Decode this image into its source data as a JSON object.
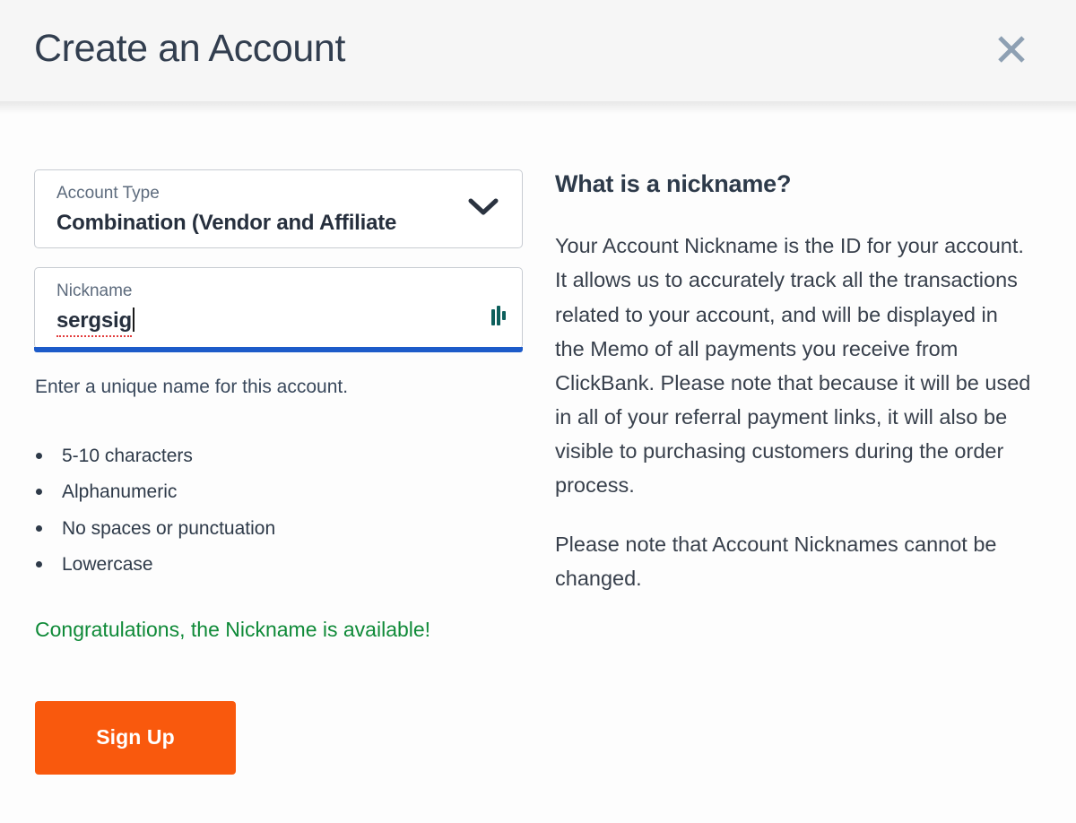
{
  "header": {
    "title": "Create an Account",
    "close_icon": "close-icon"
  },
  "form": {
    "account_type": {
      "label": "Account Type",
      "value": "Combination (Vendor and Affiliate",
      "chevron_icon": "chevron-down-icon"
    },
    "nickname": {
      "label": "Nickname",
      "value": "sergsig",
      "status_icon": "loading-bars-icon"
    },
    "helper_text": "Enter a unique name for this account.",
    "rules": [
      "5-10 characters",
      "Alphanumeric",
      "No spaces or punctuation",
      "Lowercase"
    ],
    "success_message": "Congratulations, the Nickname is available!",
    "submit_label": "Sign Up"
  },
  "info": {
    "heading": "What is a nickname?",
    "paragraphs": [
      "Your Account Nickname is the ID for your account. It allows us to accurately track all the transactions related to your account, and will be displayed in the Memo of all payments you receive from ClickBank. Please note that because it will be used in all of your referral payment links, it will also be visible to purchasing customers during the order process.",
      "Please note that Account Nicknames cannot be changed."
    ]
  },
  "colors": {
    "header_bg": "#f6f6f6",
    "title_text": "#323e4f",
    "close_icon": "#8ea0b3",
    "field_border": "#c8ccd2",
    "focus_underline": "#1d5bc9",
    "spellcheck_underline": "#e23b3b",
    "success_text": "#0f8a38",
    "button_bg": "#f9590d",
    "button_text": "#ffffff",
    "status_icon": "#0d5f5c"
  }
}
